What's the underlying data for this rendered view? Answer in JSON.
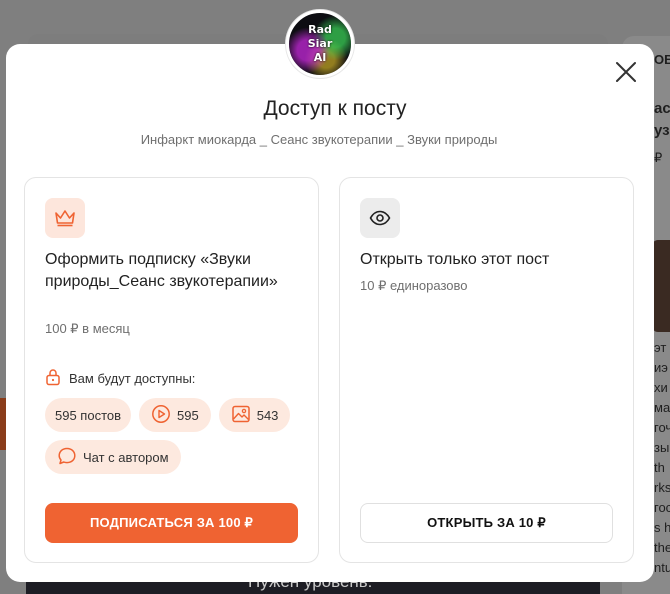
{
  "background": {
    "right_snippets": [
      "ОВ",
      "ас",
      "узь",
      "₽",
      "эт",
      "иэ",
      "хи",
      "ма",
      "гоч",
      "зы",
      "th",
      "rks",
      "гос",
      "s h",
      "the",
      "ntu"
    ],
    "bottom_text": "Нужен уровень:"
  },
  "modal": {
    "avatar_lines": [
      "Rad",
      "Siar",
      "AI"
    ],
    "title": "Доступ к посту",
    "subtitle": "Инфаркт миокарда _ Сеанс звукотерапии _ Звуки природы",
    "close_icon": "close-icon"
  },
  "subscribe_card": {
    "icon": "crown-icon",
    "title": "Оформить подписку «Звуки природы_Сеанс звукотерапии»",
    "price": "100 ₽ в месяц",
    "access_label": "Вам будут доступны:",
    "chips": {
      "posts": "595 постов",
      "videos": "595",
      "images": "543",
      "chat": "Чат с автором"
    },
    "button_label": "ПОДПИСАТЬСЯ ЗА 100 ₽"
  },
  "single_post_card": {
    "icon": "eye-icon",
    "title": "Открыть только этот пост",
    "price": "10 ₽ единоразово",
    "button_label": "ОТКРЫТЬ ЗА 10 ₽"
  },
  "colors": {
    "accent": "#ef6332",
    "accent_soft": "#fde9df"
  }
}
